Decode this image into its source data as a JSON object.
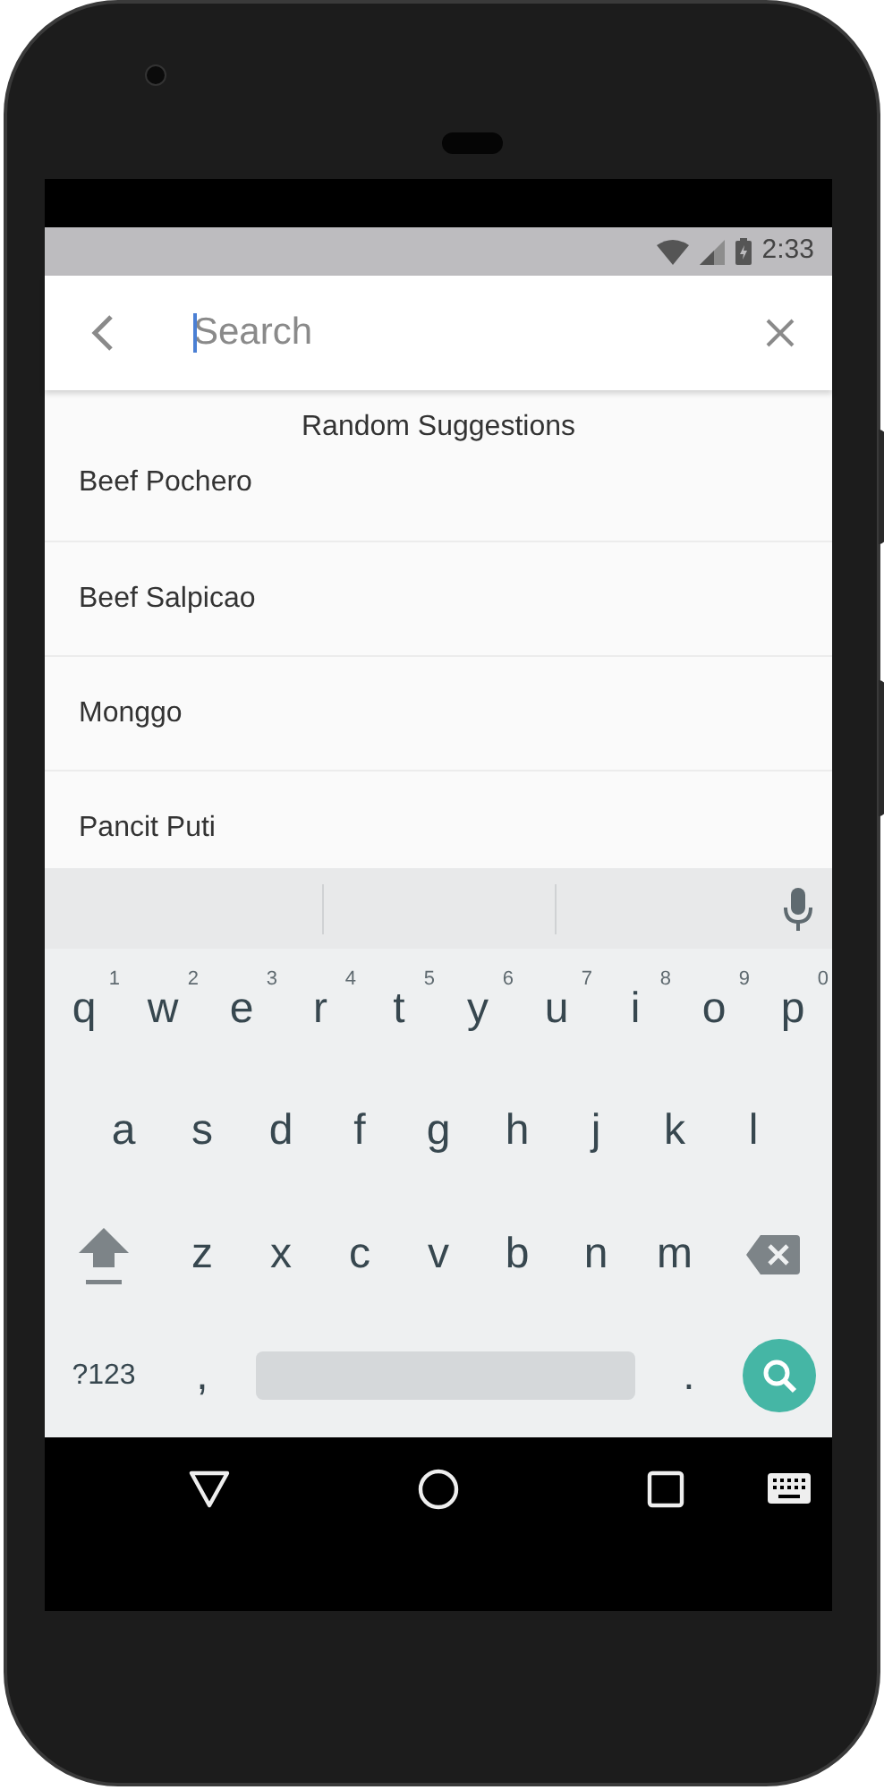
{
  "status_bar": {
    "time": "2:33"
  },
  "search": {
    "placeholder": "Search"
  },
  "suggestions": {
    "header": "Random Suggestions",
    "items": [
      {
        "label": "Beef Pochero"
      },
      {
        "label": "Beef Salpicao"
      },
      {
        "label": "Monggo"
      },
      {
        "label": "Pancit Puti"
      }
    ]
  },
  "keyboard": {
    "rows": [
      [
        {
          "kind": "letter",
          "label": "q",
          "hint": "1"
        },
        {
          "kind": "letter",
          "label": "w",
          "hint": "2"
        },
        {
          "kind": "letter",
          "label": "e",
          "hint": "3"
        },
        {
          "kind": "letter",
          "label": "r",
          "hint": "4"
        },
        {
          "kind": "letter",
          "label": "t",
          "hint": "5"
        },
        {
          "kind": "letter",
          "label": "y",
          "hint": "6"
        },
        {
          "kind": "letter",
          "label": "u",
          "hint": "7"
        },
        {
          "kind": "letter",
          "label": "i",
          "hint": "8"
        },
        {
          "kind": "letter",
          "label": "o",
          "hint": "9"
        },
        {
          "kind": "letter",
          "label": "p",
          "hint": "0"
        }
      ],
      [
        {
          "kind": "letter",
          "label": "a"
        },
        {
          "kind": "letter",
          "label": "s"
        },
        {
          "kind": "letter",
          "label": "d"
        },
        {
          "kind": "letter",
          "label": "f"
        },
        {
          "kind": "letter",
          "label": "g"
        },
        {
          "kind": "letter",
          "label": "h"
        },
        {
          "kind": "letter",
          "label": "j"
        },
        {
          "kind": "letter",
          "label": "k"
        },
        {
          "kind": "letter",
          "label": "l"
        }
      ],
      [
        {
          "kind": "shift"
        },
        {
          "kind": "letter",
          "label": "z"
        },
        {
          "kind": "letter",
          "label": "x"
        },
        {
          "kind": "letter",
          "label": "c"
        },
        {
          "kind": "letter",
          "label": "v"
        },
        {
          "kind": "letter",
          "label": "b"
        },
        {
          "kind": "letter",
          "label": "n"
        },
        {
          "kind": "letter",
          "label": "m"
        },
        {
          "kind": "backspace"
        }
      ],
      [
        {
          "kind": "symbols",
          "label": "?123"
        },
        {
          "kind": "letter",
          "label": ","
        },
        {
          "kind": "space"
        },
        {
          "kind": "letter",
          "label": "."
        },
        {
          "kind": "search"
        }
      ]
    ]
  }
}
